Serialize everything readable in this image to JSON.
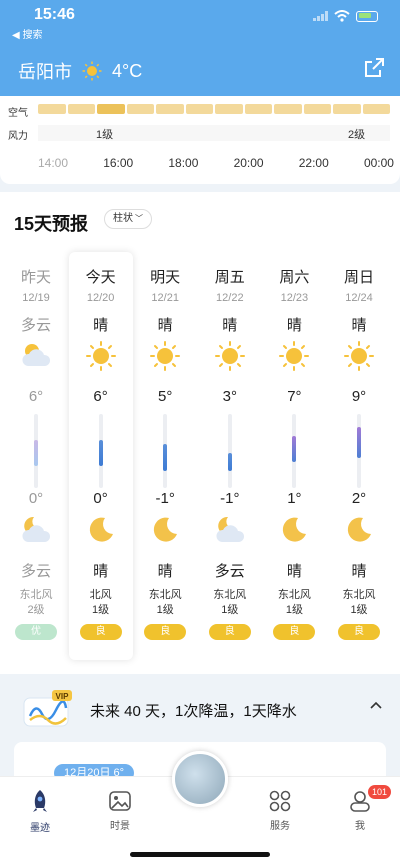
{
  "status": {
    "time": "15:46",
    "back_label": "◀ 搜索"
  },
  "header": {
    "city": "岳阳市",
    "temp": "4°C",
    "weather_icon": "sun-icon",
    "share_icon": "share-icon"
  },
  "hourly": {
    "air_label": "空气",
    "wind_label": "风力",
    "wind_now": "1级",
    "wind_later": "2级",
    "times": [
      "14:00",
      "16:00",
      "18:00",
      "20:00",
      "22:00",
      "00:00"
    ]
  },
  "forecast": {
    "title": "15天预报",
    "view_chip": "柱状",
    "days": [
      {
        "name": "昨天",
        "date": "12/19",
        "day_cond": "多云",
        "high": "6°",
        "low": "0°",
        "night_cond": "多云",
        "wind_dir": "东北风",
        "wind_level": "2级",
        "aqi": "优",
        "day_icon": "cloudy-sun-icon",
        "night_icon": "cloudy-moon-icon"
      },
      {
        "name": "今天",
        "date": "12/20",
        "day_cond": "晴",
        "high": "6°",
        "low": "0°",
        "night_cond": "晴",
        "wind_dir": "北风",
        "wind_level": "1级",
        "aqi": "良",
        "day_icon": "sun-icon",
        "night_icon": "moon-icon"
      },
      {
        "name": "明天",
        "date": "12/21",
        "day_cond": "晴",
        "high": "5°",
        "low": "-1°",
        "night_cond": "晴",
        "wind_dir": "东北风",
        "wind_level": "1级",
        "aqi": "良",
        "day_icon": "sun-icon",
        "night_icon": "moon-icon"
      },
      {
        "name": "周五",
        "date": "12/22",
        "day_cond": "晴",
        "high": "3°",
        "low": "-1°",
        "night_cond": "多云",
        "wind_dir": "东北风",
        "wind_level": "1级",
        "aqi": "良",
        "day_icon": "sun-icon",
        "night_icon": "cloudy-moon-icon"
      },
      {
        "name": "周六",
        "date": "12/23",
        "day_cond": "晴",
        "high": "7°",
        "low": "1°",
        "night_cond": "晴",
        "wind_dir": "东北风",
        "wind_level": "1级",
        "aqi": "良",
        "day_icon": "sun-icon",
        "night_icon": "moon-icon"
      },
      {
        "name": "周日",
        "date": "12/24",
        "day_cond": "晴",
        "high": "9°",
        "low": "2°",
        "night_cond": "晴",
        "wind_dir": "东北风",
        "wind_level": "1级",
        "aqi": "良",
        "day_icon": "sun-icon",
        "night_icon": "moon-icon"
      }
    ]
  },
  "banner": {
    "vip": "VIP",
    "text": "未来 40 天，1次降温，1天降水"
  },
  "history": {
    "pill": "12月20日 6°"
  },
  "tabbar": {
    "items": [
      {
        "label": "墨迹",
        "icon": "rocket-icon"
      },
      {
        "label": "时景",
        "icon": "image-icon"
      },
      {
        "label": "服务",
        "icon": "grid-icon"
      },
      {
        "label": "我",
        "icon": "profile-icon"
      }
    ],
    "badge": "101"
  },
  "colors": {
    "header": "#5aa9ec",
    "aqi_good": "#f0c22d",
    "aqi_excellent": "#bde6cd"
  }
}
